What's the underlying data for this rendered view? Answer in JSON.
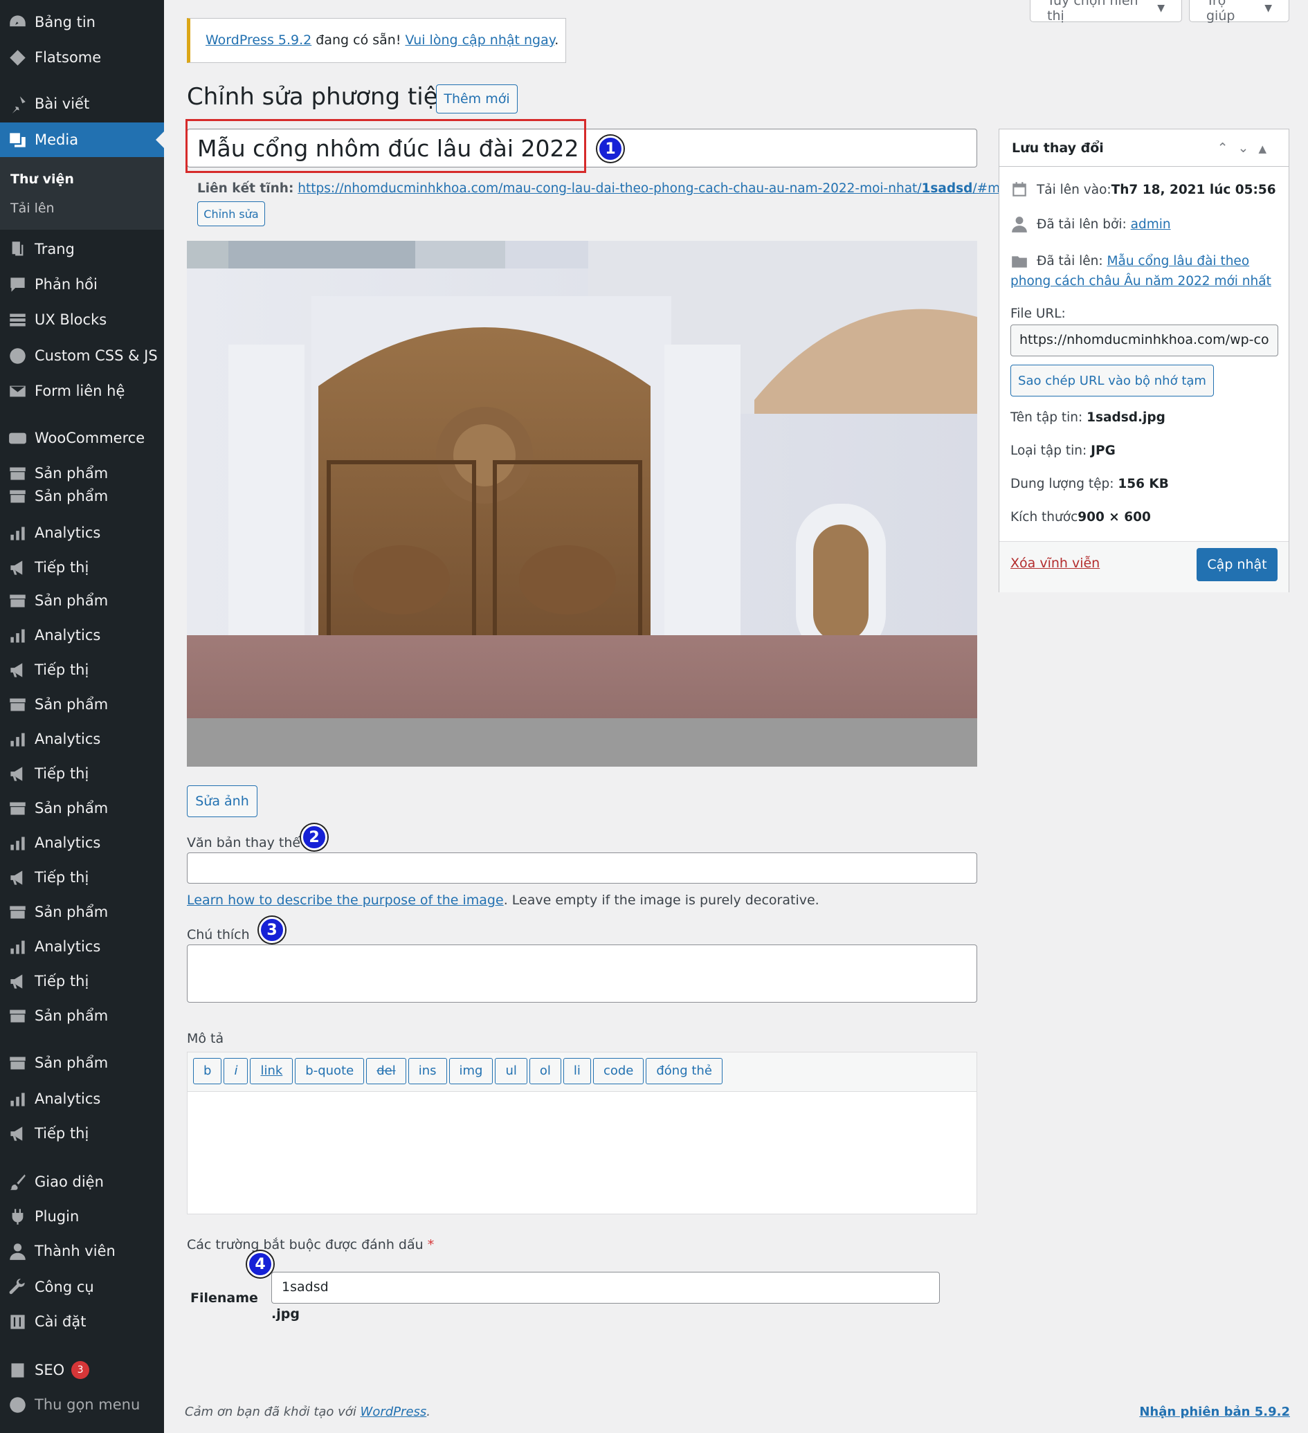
{
  "sidebar": {
    "items": [
      {
        "label": "Bảng tin",
        "icon": "dashboard-icon"
      },
      {
        "label": "Flatsome",
        "icon": "flatsome-icon"
      },
      {
        "label": "Bài viết",
        "icon": "pin-icon"
      },
      {
        "label": "Media",
        "icon": "media-icon"
      },
      {
        "label": "Trang",
        "icon": "page-icon"
      },
      {
        "label": "Phản hồi",
        "icon": "comment-icon"
      },
      {
        "label": "UX Blocks",
        "icon": "blocks-icon"
      },
      {
        "label": "Custom CSS & JS",
        "icon": "plus-circle-icon"
      },
      {
        "label": "Form liên hệ",
        "icon": "mail-icon"
      },
      {
        "label": "WooCommerce",
        "icon": "woo-icon"
      },
      {
        "label": "Sản phẩm",
        "icon": "archive-icon"
      },
      {
        "label": "Sản phẩm",
        "icon": "archive-icon"
      },
      {
        "label": "Analytics",
        "icon": "bar-chart-icon"
      },
      {
        "label": "Tiếp thị",
        "icon": "megaphone-icon"
      },
      {
        "label": "Sản phẩm",
        "icon": "archive-icon"
      },
      {
        "label": "Analytics",
        "icon": "bar-chart-icon"
      },
      {
        "label": "Tiếp thị",
        "icon": "megaphone-icon"
      },
      {
        "label": "Sản phẩm",
        "icon": "archive-icon"
      },
      {
        "label": "Analytics",
        "icon": "bar-chart-icon"
      },
      {
        "label": "Tiếp thị",
        "icon": "megaphone-icon"
      },
      {
        "label": "Sản phẩm",
        "icon": "archive-icon"
      },
      {
        "label": "Analytics",
        "icon": "bar-chart-icon"
      },
      {
        "label": "Tiếp thị",
        "icon": "megaphone-icon"
      },
      {
        "label": "Sản phẩm",
        "icon": "archive-icon"
      },
      {
        "label": "Analytics",
        "icon": "bar-chart-icon"
      },
      {
        "label": "Tiếp thị",
        "icon": "megaphone-icon"
      },
      {
        "label": "Sản phẩm",
        "icon": "archive-icon"
      },
      {
        "label": "Sản phẩm",
        "icon": "archive-icon"
      },
      {
        "label": "Analytics",
        "icon": "bar-chart-icon"
      },
      {
        "label": "Tiếp thị",
        "icon": "megaphone-icon"
      },
      {
        "label": "Giao diện",
        "icon": "brush-icon"
      },
      {
        "label": "Plugin",
        "icon": "plug-icon"
      },
      {
        "label": "Thành viên",
        "icon": "user-icon"
      },
      {
        "label": "Công cụ",
        "icon": "wrench-icon"
      },
      {
        "label": "Cài đặt",
        "icon": "settings-icon"
      },
      {
        "label": "SEO",
        "icon": "seo-icon",
        "badge": "3"
      },
      {
        "label": "Thu gọn menu",
        "icon": "collapse-icon"
      }
    ],
    "submenu": {
      "library": "Thư viện",
      "upload": "Tải lên"
    }
  },
  "top": {
    "screen_options": "Tùy chọn hiển thị",
    "help": "Trợ giúp"
  },
  "notice": {
    "link1": "WordPress 5.9.2",
    "text": " đang có sẵn! ",
    "link2": "Vui lòng cập nhật ngay",
    "end": "."
  },
  "page": {
    "title": "Chỉnh sửa phương tiện",
    "add_new": "Thêm mới"
  },
  "media": {
    "title_value": "Mẫu cổng nhôm đúc lâu đài 2022",
    "permalink_label": "Liên kết tĩnh:",
    "permalink_url_a": "https://nhomducminhkhoa.com/mau-cong-lau-dai-theo-phong-cach-chau-au-nam-2022-moi-nhat/",
    "permalink_url_b": "1sadsd",
    "permalink_url_c": "/#main",
    "edit_permalink": "Chỉnh sửa",
    "edit_image": "Sửa ảnh",
    "alt_label": "Văn bản thay thế",
    "alt_help_link": "Learn how to describe the purpose of the image",
    "alt_help_text": ". Leave empty if the image is purely decorative.",
    "caption_label": "Chú thích",
    "desc_label": "Mô tả",
    "quicktags": [
      "b",
      "i",
      "link",
      "b-quote",
      "del",
      "ins",
      "img",
      "ul",
      "ol",
      "li",
      "code",
      "đóng thẻ"
    ],
    "required_note": "Các trường bắt buộc được đánh dấu ",
    "required_star": "*",
    "filename_label": "Filename",
    "filename_value": "1sadsd",
    "filename_ext": ".jpg"
  },
  "markers": [
    "1",
    "2",
    "3",
    "4"
  ],
  "savebox": {
    "title": "Lưu thay đổi",
    "uploaded_on_label": "Tải lên vào: ",
    "uploaded_on_value": "Th7 18, 2021 lúc 05:56",
    "uploaded_by_label": "Đã tải lên bởi: ",
    "uploaded_by_value": "admin",
    "uploaded_to_label": "Đã tải lên: ",
    "uploaded_to_value": "Mẫu cổng lâu đài theo phong cách châu Âu năm 2022 mới nhất",
    "file_url_label": "File URL:",
    "file_url_value": "https://nhomducminhkhoa.com/wp-co",
    "copy_url": "Sao chép URL vào bộ nhớ tạm",
    "filename_label": "Tên tập tin: ",
    "filename_value": "1sadsd.jpg",
    "filetype_label": "Loại tập tin: ",
    "filetype_value": "JPG",
    "filesize_label": "Dung lượng tệp: ",
    "filesize_value": "156 KB",
    "dimensions_label": "Kích thước ",
    "dimensions_value": "900 × 600",
    "delete": "Xóa vĩnh viễn",
    "update": "Cập nhật"
  },
  "footer": {
    "thanks": "Cảm ơn bạn đã khởi tạo với ",
    "wp": "WordPress",
    "dot": ".",
    "version": "Nhận phiên bản 5.9.2"
  },
  "colors": {
    "accent": "#2271b1",
    "sidebar": "#1d2327",
    "marker": "#1621d6",
    "highlight_box": "#d62b2b"
  }
}
